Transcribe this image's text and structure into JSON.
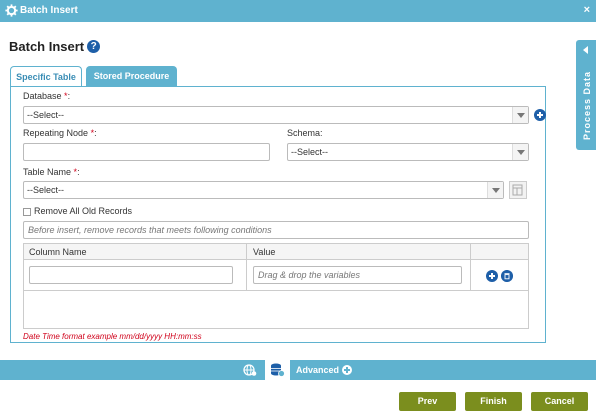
{
  "window": {
    "title": "Batch Insert",
    "close_glyph": "×",
    "icon": "gear-icon"
  },
  "page": {
    "heading": "Batch Insert",
    "help_glyph": "?"
  },
  "tabs": [
    {
      "label": "Specific Table",
      "active": true
    },
    {
      "label": "Stored Procedure",
      "active": false
    }
  ],
  "form": {
    "database": {
      "label": "Database",
      "required_mark": "*",
      "suffix": ":",
      "value": "--Select--"
    },
    "repeating_node": {
      "label": "Repeating Node",
      "required_mark": "*",
      "suffix": ":",
      "value": ""
    },
    "schema": {
      "label": "Schema:",
      "value": "--Select--"
    },
    "table_name": {
      "label": "Table Name",
      "required_mark": "*",
      "suffix": ":",
      "value": "--Select--"
    },
    "remove_all": {
      "label": "Remove All Old Records",
      "checked": false
    },
    "conditions": {
      "placeholder": "Before insert, remove records that meets following conditions"
    }
  },
  "grid": {
    "headers": [
      "Column Name",
      "Value",
      ""
    ],
    "rows": [
      {
        "column_name": "",
        "value_placeholder": "Drag & drop the variables"
      }
    ]
  },
  "note": "Date Time format example mm/dd/yyyy HH:mm:ss",
  "side_panel": {
    "label": "Process Data"
  },
  "bottom_bar": {
    "advanced_label": "Advanced"
  },
  "buttons": {
    "prev": "Prev",
    "finish": "Finish",
    "cancel": "Cancel"
  },
  "colors": {
    "accent": "#5fb2cf",
    "button": "#7b8e1e",
    "icon_blue": "#1e5fa8",
    "required": "#d0021b"
  }
}
